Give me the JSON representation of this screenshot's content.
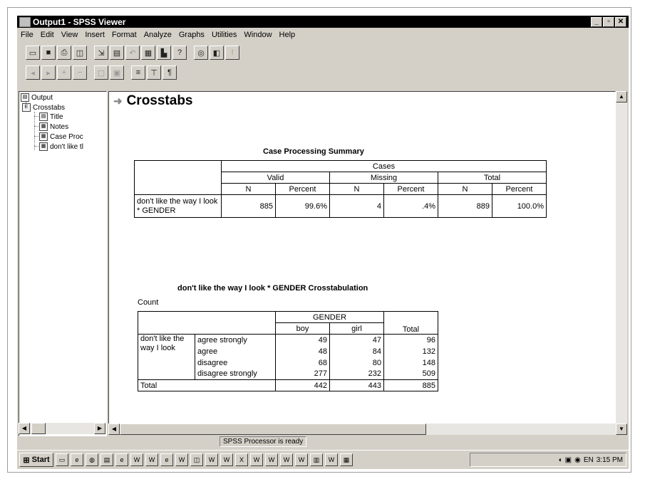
{
  "window": {
    "title": "Output1 - SPSS Viewer"
  },
  "menu": [
    "File",
    "Edit",
    "View",
    "Insert",
    "Format",
    "Analyze",
    "Graphs",
    "Utilities",
    "Window",
    "Help"
  ],
  "outline": {
    "root": "Output",
    "group": "Crosstabs",
    "items": [
      "Title",
      "Notes",
      "Case Proc",
      "don't like tl"
    ]
  },
  "heading": "Crosstabs",
  "summary": {
    "title": "Case Processing Summary",
    "cases": "Cases",
    "groups": [
      "Valid",
      "Missing",
      "Total"
    ],
    "n": "N",
    "percent": "Percent",
    "row_label": "don't like the way I look * GENDER",
    "values": [
      "885",
      "99.6%",
      "4",
      ".4%",
      "889",
      "100.0%"
    ]
  },
  "crosstab": {
    "title": "don't like the way I look * GENDER Crosstabulation",
    "count_label": "Count",
    "gender": "GENDER",
    "cols": [
      "boy",
      "girl",
      "Total"
    ],
    "row_var": "don't like the way I look",
    "rows": [
      {
        "label": "agree strongly",
        "values": [
          "49",
          "47",
          "96"
        ]
      },
      {
        "label": "agree",
        "values": [
          "48",
          "84",
          "132"
        ]
      },
      {
        "label": "disagree",
        "values": [
          "68",
          "80",
          "148"
        ]
      },
      {
        "label": "disagree strongly",
        "values": [
          "277",
          "232",
          "509"
        ]
      }
    ],
    "total_label": "Total",
    "totals": [
      "442",
      "443",
      "885"
    ]
  },
  "status": "SPSS Processor  is ready",
  "taskbar": {
    "start": "Start",
    "time": "3:15 PM"
  }
}
